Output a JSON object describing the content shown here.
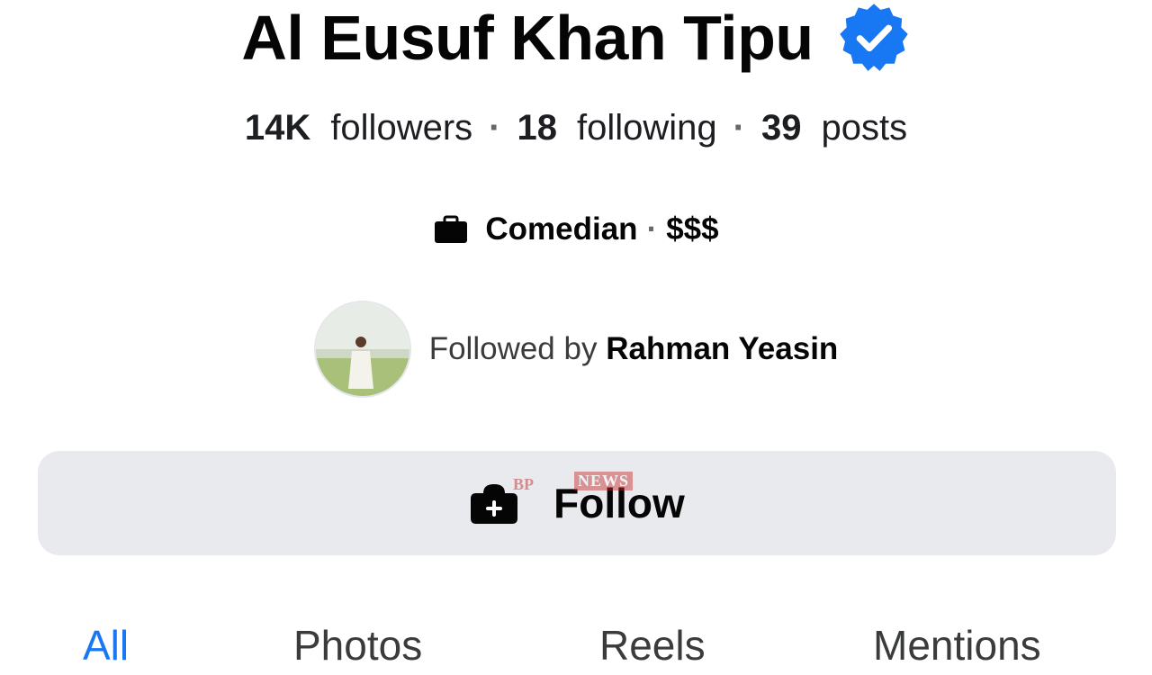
{
  "profile": {
    "name": "Al Eusuf Khan Tipu",
    "verified_icon": "verified-badge-icon",
    "accent_color": "#1877f2"
  },
  "stats": {
    "followers_count": "14K",
    "followers_label": "followers",
    "following_count": "18",
    "following_label": "following",
    "posts_count": "39",
    "posts_label": "posts",
    "separator": "·"
  },
  "category": {
    "icon": "briefcase-icon",
    "label": "Comedian",
    "separator": "·",
    "price": "$$$"
  },
  "followed_by": {
    "prefix": "Followed by",
    "name": "Rahman Yeasin"
  },
  "follow_button": {
    "label": "Follow",
    "icon": "follow-add-icon",
    "background": "#e9eaee"
  },
  "watermark": {
    "brand": "BP",
    "news": "NEWS"
  },
  "tabs": [
    {
      "label": "All"
    },
    {
      "label": "Photos"
    },
    {
      "label": "Reels"
    },
    {
      "label": "Mentions"
    }
  ]
}
